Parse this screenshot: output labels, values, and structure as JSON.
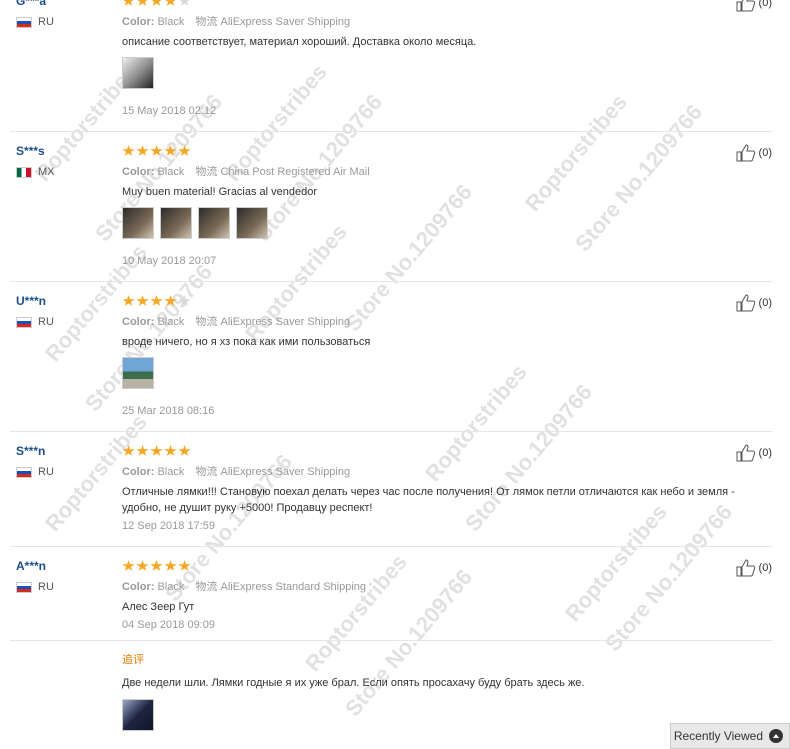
{
  "helpful_icon": "thumbs-up-icon",
  "star_color": "#f5a623",
  "username_color": "#1c4f8a",
  "reviews": [
    {
      "user": "G***a",
      "country": "RU",
      "rating": 4,
      "color_label": "Color:",
      "color_value": "Black",
      "shipping_label": "物流",
      "shipping": "AliExpress Saver Shipping",
      "text": "описание соответствует, материал хороший. Доставка около месяца.",
      "date": "15 May 2018 02:12",
      "helpful": "(0)"
    },
    {
      "user": "S***s",
      "country": "MX",
      "rating": 5,
      "color_label": "Color:",
      "color_value": "Black",
      "shipping_label": "物流",
      "shipping": "China Post Registered Air Mail",
      "text": "Muy buen material! Gracias al vendedor",
      "date": "10 May 2018 20:07",
      "helpful": "(0)"
    },
    {
      "user": "U***n",
      "country": "RU",
      "rating": 4,
      "color_label": "Color:",
      "color_value": "Black",
      "shipping_label": "物流",
      "shipping": "AliExpress Saver Shipping",
      "text": "вроде ничего, но я хз пока как ими пользоваться",
      "date": "25 Mar 2018 08:16",
      "helpful": "(0)"
    },
    {
      "user": "S***n",
      "country": "RU",
      "rating": 5,
      "color_label": "Color:",
      "color_value": "Black",
      "shipping_label": "物流",
      "shipping": "AliExpress Saver Shipping",
      "text": "Отличные лямки!!! Становую поехал делать через час после получения! От лямок петли отличаются как небо и земля - удобно, не душит руку +5000! Продавцу респект!",
      "date": "12 Sep 2018 17:59",
      "helpful": "(0)"
    },
    {
      "user": "A***n",
      "country": "RU",
      "rating": 5,
      "color_label": "Color:",
      "color_value": "Black",
      "shipping_label": "物流",
      "shipping": "AliExpress Standard Shipping",
      "text": "Алес Зеер Гут",
      "date": "04 Sep 2018 09:09",
      "helpful": "(0)",
      "followup_label": "追评",
      "followup_text": "Две недели шли. Лямки годные я их уже брал. Если опять просахачу буду брать здесь же."
    }
  ],
  "watermarks": [
    "Roptorstribes",
    "Store No.1209766"
  ],
  "recently_viewed": "Recently Viewed"
}
